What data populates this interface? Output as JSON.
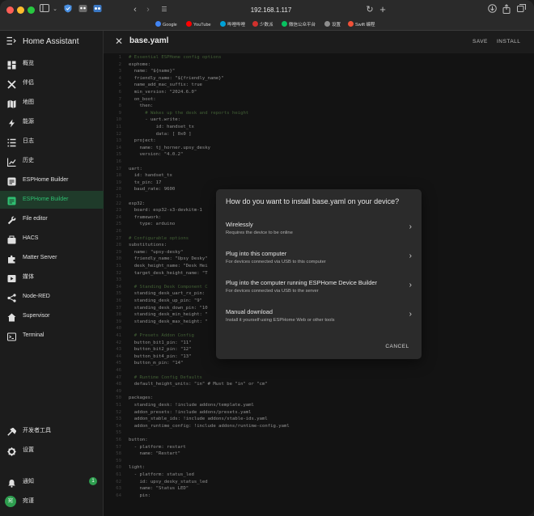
{
  "browser": {
    "url": "192.168.1.117",
    "bookmarks": [
      {
        "label": "Google",
        "color": "#4285f4"
      },
      {
        "label": "YouTube",
        "color": "#ff0000"
      },
      {
        "label": "哔哩哔哩",
        "color": "#00a1d6"
      },
      {
        "label": "少数派",
        "color": "#d0312d"
      },
      {
        "label": "微信公众平台",
        "color": "#07c160"
      },
      {
        "label": "设置",
        "color": "#8e8e8e"
      },
      {
        "label": "Swift 编程",
        "color": "#f05138"
      }
    ]
  },
  "sidebar": {
    "title": "Home Assistant",
    "items": [
      {
        "label": "概览",
        "icon": "dashboard-icon"
      },
      {
        "label": "伴侣",
        "icon": "tools-icon"
      },
      {
        "label": "地图",
        "icon": "map-icon"
      },
      {
        "label": "能源",
        "icon": "lightning-icon"
      },
      {
        "label": "日志",
        "icon": "logbook-icon"
      },
      {
        "label": "历史",
        "icon": "history-icon"
      },
      {
        "label": "ESPHome Builder",
        "icon": "esphome-icon"
      },
      {
        "label": "ESPHome Builder",
        "icon": "esphome-icon",
        "active": true
      },
      {
        "label": "File editor",
        "icon": "wrench-icon"
      },
      {
        "label": "HACS",
        "icon": "hacs-icon"
      },
      {
        "label": "Matter Server",
        "icon": "puzzle-icon"
      },
      {
        "label": "媒体",
        "icon": "media-icon"
      },
      {
        "label": "Node-RED",
        "icon": "nodered-icon"
      },
      {
        "label": "Supervisor",
        "icon": "supervisor-icon"
      },
      {
        "label": "Terminal",
        "icon": "terminal-icon"
      }
    ],
    "bottom": [
      {
        "label": "开发者工具",
        "icon": "hammer-icon"
      },
      {
        "label": "设置",
        "icon": "gear-icon"
      },
      {
        "label": "通知",
        "icon": "bell-icon",
        "badge": "1"
      },
      {
        "label": "宛谨",
        "avatar": "宛"
      }
    ],
    "accent": "#2fbf71"
  },
  "editor": {
    "filename": "base.yaml",
    "save_label": "SAVE",
    "install_label": "INSTALL",
    "lines": [
      "# Essential ESPHome config options",
      "esphome:",
      "  name: \"${name}\"",
      "  friendly_name: \"${friendly_name}\"",
      "  name_add_mac_suffix: true",
      "  min_version: \"2024.6.0\"",
      "  on_boot:",
      "    then:",
      "      # Wakes up the desk and reports height",
      "      - uart.write:",
      "          id: handset_tx",
      "          data: [ 0x0 ]",
      "  project:",
      "    name: tj_horner.upsy_desky",
      "    version: \"4.0.2\"",
      "",
      "uart:",
      "  id: handset_tx",
      "  tx_pin: 17",
      "  baud_rate: 9600",
      "",
      "esp32:",
      "  board: esp32-s3-devkitm-1",
      "  framework:",
      "    type: arduino",
      "",
      "# Configurable options",
      "substitutions:",
      "  name: \"upsy-desky\"",
      "  friendly_name: \"Upsy Desky\"",
      "  desk_height_name: \"Desk Hei",
      "  target_desk_height_name: \"T",
      "",
      "  # Standing Desk Component C",
      "  standing_desk_uart_rx_pin:",
      "  standing_desk_up_pin: \"9\"",
      "  standing_desk_down_pin: \"10",
      "  standing_desk_min_height: \"",
      "  standing_desk_max_height: \"",
      "",
      "  # Presets Addon Config",
      "  button_bit1_pin: \"11\"",
      "  button_bit2_pin: \"12\"",
      "  button_bit4_pin: \"13\"",
      "  button_m_pin: \"14\"",
      "",
      "  # Runtime Config Defaults",
      "  default_height_units: \"in\" # Must be \"in\" or \"cm\"",
      "",
      "packages:",
      "  standing_desk: !include addons/template.yaml",
      "  addon_presets: !include addons/presets.yaml",
      "  addon_stable_ids: !include addons/stable-ids.yaml",
      "  addon_runtime_config: !include addons/runtime-config.yaml",
      "",
      "button:",
      "  - platform: restart",
      "    name: \"Restart\"",
      "",
      "light:",
      "  - platform: status_led",
      "    id: upsy_desky_status_led",
      "    name: \"Status LED\"",
      "    pin:"
    ]
  },
  "dialog": {
    "title": "How do you want to install base.yaml on your device?",
    "options": [
      {
        "title": "Wirelessly",
        "subtitle": "Requires the device to be online"
      },
      {
        "title": "Plug into this computer",
        "subtitle": "For devices connected via USB to this computer"
      },
      {
        "title": "Plug into the computer running ESPHome Device Builder",
        "subtitle": "For devices connected via USB to the server"
      },
      {
        "title": "Manual download",
        "subtitle": "Install it yourself using ESPHome Web or other tools"
      }
    ],
    "cancel_label": "CANCEL"
  }
}
